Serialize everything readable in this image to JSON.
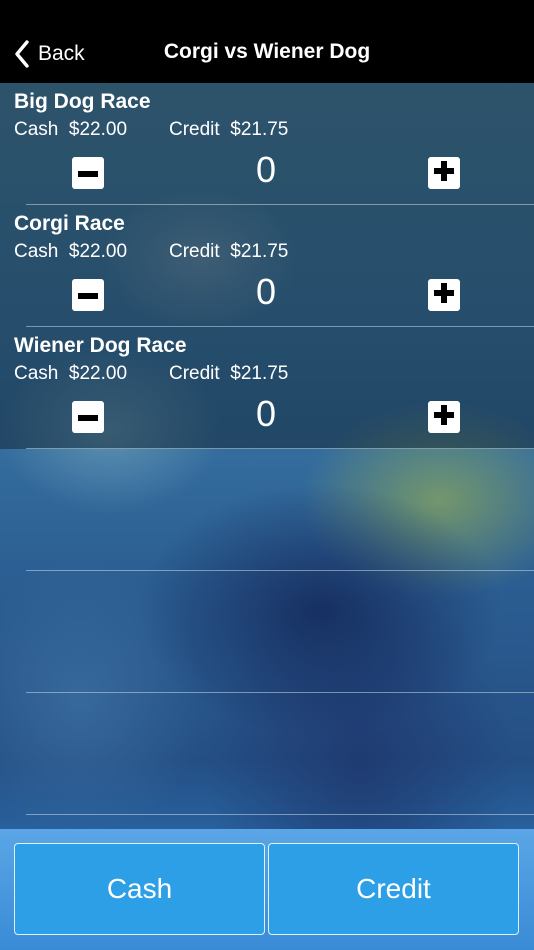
{
  "nav": {
    "back_label": "Back",
    "title": "Corgi vs Wiener Dog"
  },
  "races": [
    {
      "name": "Big Dog Race",
      "cash_label": "Cash",
      "cash_price": "$22.00",
      "credit_label": "Credit",
      "credit_price": "$21.75",
      "quantity": "0"
    },
    {
      "name": "Corgi Race",
      "cash_label": "Cash",
      "cash_price": "$22.00",
      "credit_label": "Credit",
      "credit_price": "$21.75",
      "quantity": "0"
    },
    {
      "name": "Wiener Dog Race",
      "cash_label": "Cash",
      "cash_price": "$22.00",
      "credit_label": "Credit",
      "credit_price": "$21.75",
      "quantity": "0"
    }
  ],
  "actions": {
    "cash_label": "Cash",
    "credit_label": "Credit"
  },
  "colors": {
    "nav_background": "#000000",
    "action_button": "#2c9fe6",
    "stepper_button": "#ffffff"
  },
  "icons": {
    "back": "chevron-left-icon",
    "decrease": "minus-icon",
    "increase": "plus-icon"
  }
}
